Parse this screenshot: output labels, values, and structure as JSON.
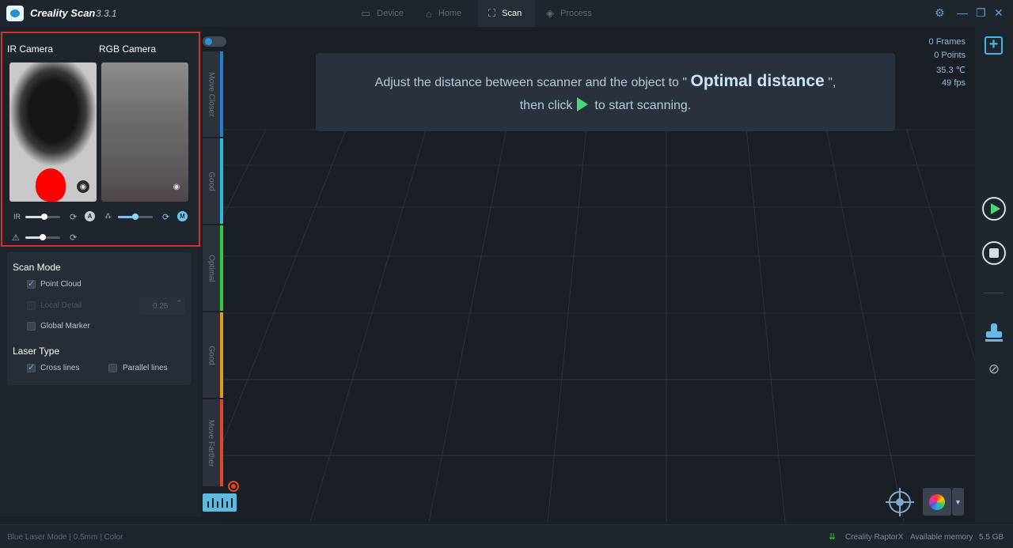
{
  "app": {
    "title": "Creality Scan",
    "version": "3.3.1"
  },
  "tabs": [
    {
      "label": "Device",
      "icon": "device-icon",
      "active": false
    },
    {
      "label": "Home",
      "icon": "home-icon",
      "active": false
    },
    {
      "label": "Scan",
      "icon": "scan-icon",
      "active": true
    },
    {
      "label": "Process",
      "icon": "process-icon",
      "active": false
    }
  ],
  "cameras": {
    "ir_label": "IR Camera",
    "rgb_label": "RGB Camera",
    "ir_slider_label": "IR",
    "ir_exposure": 0.55,
    "rgb_exposure": 0.5,
    "laser_brightness": 0.5,
    "ir_mode_badge": "A",
    "rgb_mode_badge": "M"
  },
  "scan_mode": {
    "title": "Scan Mode",
    "options": [
      {
        "label": "Point Cloud",
        "checked": true,
        "enabled": true
      },
      {
        "label": "Local Detail",
        "checked": false,
        "enabled": false
      },
      {
        "label": "Global Marker",
        "checked": false,
        "enabled": true
      }
    ],
    "local_detail_value": "0.25"
  },
  "laser_type": {
    "title": "Laser Type",
    "options": [
      {
        "label": "Cross lines",
        "checked": true
      },
      {
        "label": "Parallel lines",
        "checked": false
      }
    ]
  },
  "distance_bar": {
    "segments": [
      {
        "label": "Move Closer",
        "color": "#1f7fd8"
      },
      {
        "label": "Good",
        "color": "#2bb9e0"
      },
      {
        "label": "Optimal",
        "color": "#2fcc3c"
      },
      {
        "label": "Good",
        "color": "#e69a1c"
      },
      {
        "label": "Move Farther",
        "color": "#e8432b"
      }
    ]
  },
  "hint": {
    "line1_pre": "Adjust the distance between scanner and the object to \"",
    "line1_em": "Optimal distance",
    "line1_post": "\",",
    "line2_pre": "then click",
    "line2_post": "to start scanning."
  },
  "stats": {
    "frames": "0 Frames",
    "points": "0 Points",
    "temperature": "35.3 ℃",
    "fps": "49 fps"
  },
  "statusbar": {
    "mode": "Blue Laser Mode",
    "resolution": "0.5mm",
    "texture": "Color",
    "device": "Creality RaptorX",
    "memory_label": "Available memory",
    "memory_value": "5.5 GB"
  },
  "colors": {
    "accent": "#47b3e6",
    "play": "#4fd47c",
    "highlight_border": "#d9302b"
  }
}
